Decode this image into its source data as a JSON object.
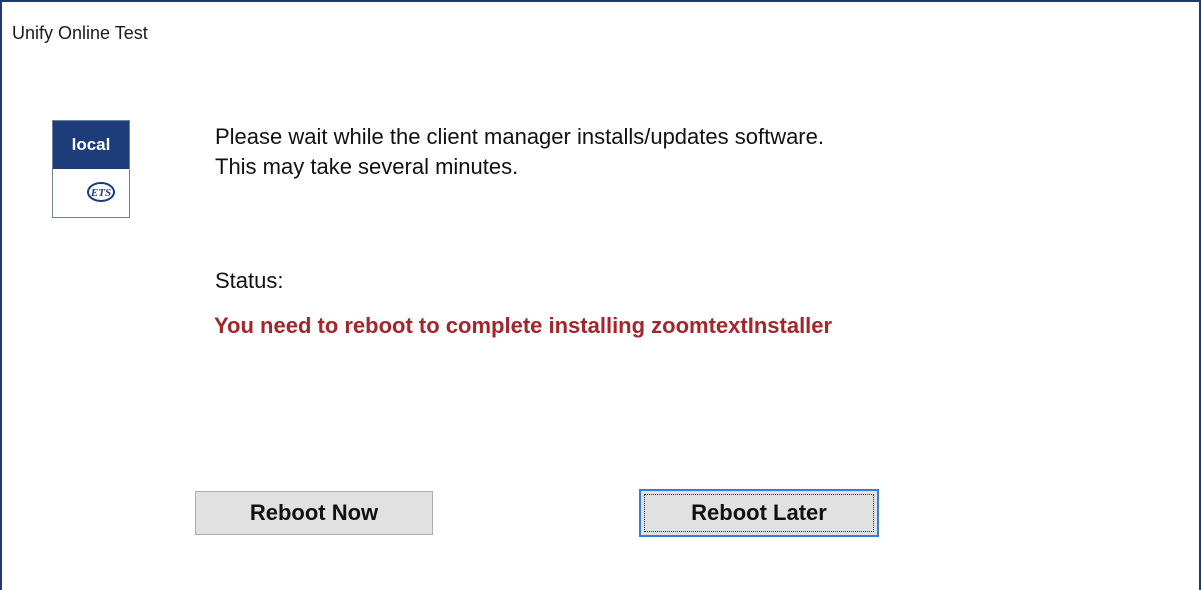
{
  "window": {
    "title": "Unify Online Test"
  },
  "logo": {
    "top_text": "local",
    "bottom_text": "ETS",
    "brand_color": "#1c3c7a"
  },
  "message": {
    "line1": "Please wait while the client manager installs/updates software.",
    "line2": "This may take several minutes."
  },
  "status": {
    "label": "Status:",
    "text": "You need to reboot to complete installing zoomtextInstaller",
    "color": "#a3262a"
  },
  "buttons": {
    "reboot_now": "Reboot Now",
    "reboot_later": "Reboot Later"
  }
}
